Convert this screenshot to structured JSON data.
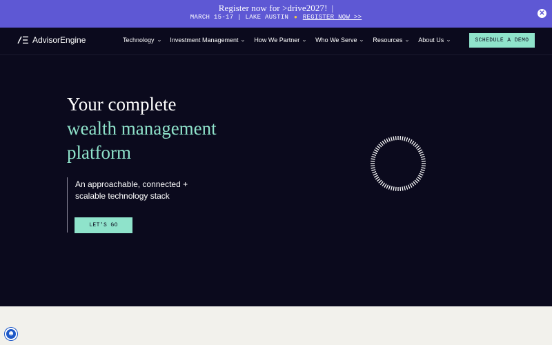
{
  "banner": {
    "title": "Register now for >drive2027!",
    "pipe": "|",
    "subtitle_left": "MARCH 15-17 | LAKE AUSTIN",
    "sun_icon": "sun-icon",
    "link": "REGISTER NOW >>",
    "close_icon": "close-icon"
  },
  "nav": {
    "logo_text": "AdvisorEngine",
    "items": [
      {
        "label": "Technology"
      },
      {
        "label": "Investment Management"
      },
      {
        "label": "How We Partner"
      },
      {
        "label": "Who We Serve"
      },
      {
        "label": "Resources"
      },
      {
        "label": "About Us"
      }
    ],
    "cta": "SCHEDULE A DEMO"
  },
  "hero": {
    "title_line1": "Your complete",
    "title_line2": "wealth management",
    "title_line3": "platform",
    "subtitle_line1": "An approachable, connected +",
    "subtitle_line2": "scalable technology stack",
    "cta": "LET'S GO"
  },
  "colors": {
    "banner_bg": "#5e58d4",
    "page_bg": "#0b0a1d",
    "accent": "#8fe3cb",
    "lower_bg": "#f2f1ec",
    "accessibility": "#1e59c8"
  },
  "accessibility_icon": "accessibility-icon"
}
